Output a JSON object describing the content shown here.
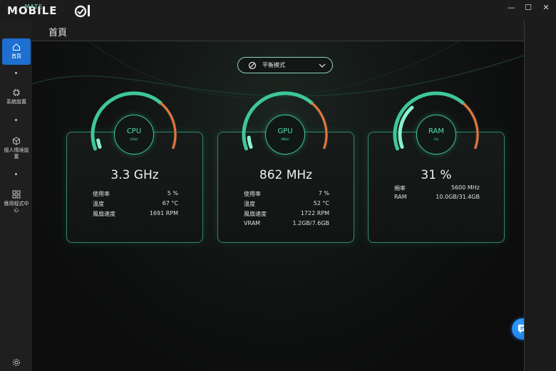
{
  "app": {
    "logo_text": "MOBILE",
    "logo_sub": "MATE"
  },
  "window": {
    "minimize": "—",
    "maximize": "☐",
    "close": "✕"
  },
  "sidebar": {
    "items": [
      {
        "label": "首頁",
        "icon": "home-icon"
      },
      {
        "label": "系統設置",
        "icon": "chip-icon"
      },
      {
        "label": "個人情境設置",
        "icon": "cube-icon"
      },
      {
        "label": "應用程式中心",
        "icon": "apps-grid-icon"
      }
    ]
  },
  "header": {
    "title": "首頁"
  },
  "mode": {
    "label": "平衡模式"
  },
  "cards": {
    "cpu": {
      "name": "CPU",
      "unit": "(GHz)",
      "value": "3.3 GHz",
      "usage_fraction": 0.05,
      "rows": [
        {
          "label": "使用率",
          "value": "5 %"
        },
        {
          "label": "溫度",
          "value": "67 °C"
        },
        {
          "label": "風扇速度",
          "value": "1691 RPM"
        }
      ]
    },
    "gpu": {
      "name": "GPU",
      "unit": "(MHz)",
      "value": "862 MHz",
      "usage_fraction": 0.07,
      "rows": [
        {
          "label": "使用率",
          "value": "7 %"
        },
        {
          "label": "溫度",
          "value": "52 °C"
        },
        {
          "label": "風扇速度",
          "value": "1722 RPM"
        },
        {
          "label": "VRAM",
          "value": "1.2GB/7.6GB"
        }
      ]
    },
    "ram": {
      "name": "RAM",
      "unit": "(%)",
      "value": "31 %",
      "usage_fraction": 0.31,
      "rows": [
        {
          "label": "頻率",
          "value": "5600 MHz"
        },
        {
          "label": "RAM",
          "value": "10.0GB/31.4GB"
        }
      ]
    }
  },
  "colors": {
    "accent_active": "#1e6fd0",
    "gauge_green": "#3ec79a",
    "gauge_orange": "#e8763a",
    "card_border": "#2f8a6c"
  }
}
